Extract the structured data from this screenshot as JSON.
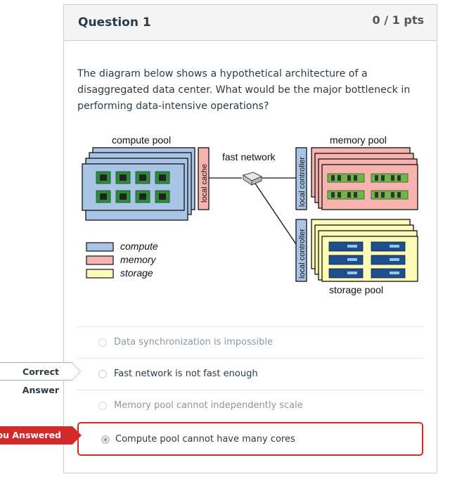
{
  "question": {
    "title": "Question 1",
    "points": "0 / 1 pts",
    "text": "The diagram below shows a hypothetical architecture of a disaggregated data center. What would be the major bottleneck in performing data-intensive operations?"
  },
  "diagram": {
    "compute_pool_label": "compute pool",
    "memory_pool_label": "memory pool",
    "storage_pool_label": "storage pool",
    "network_label": "fast network",
    "local_cache_label": "local cache",
    "local_controller_label": "local controller",
    "legend": [
      {
        "label": "compute",
        "color": "#a9c5e6"
      },
      {
        "label": "memory",
        "color": "#f7b3b0"
      },
      {
        "label": "storage",
        "color": "#fdfbb8"
      }
    ]
  },
  "answers": [
    {
      "label": "Data synchronization is impossible",
      "state": "dim"
    },
    {
      "label": "Fast network is not fast enough",
      "state": "correct"
    },
    {
      "label": "Memory pool cannot independently scale",
      "state": "dim"
    },
    {
      "label": "Compute pool cannot have many cores",
      "state": "selected"
    }
  ],
  "tags": {
    "correct": "Correct Answer",
    "you_answered": "You Answered"
  },
  "colors": {
    "wrong_accent": "#d52a2a",
    "header_bg": "#f5f5f5",
    "compute": "#a9c5e6",
    "memory": "#f7b3b0",
    "storage": "#fdfbb8"
  }
}
